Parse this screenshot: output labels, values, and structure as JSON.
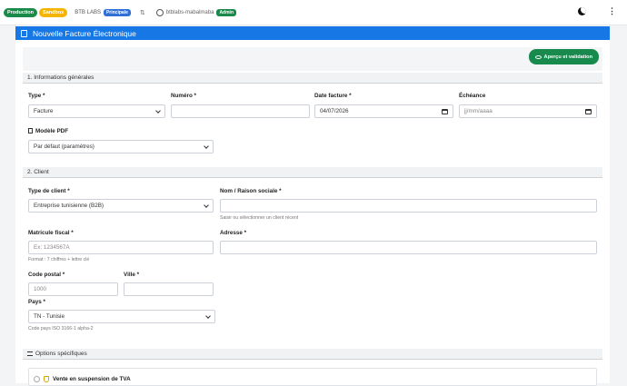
{
  "topbar": {
    "env_production": "Production",
    "env_sandbox": "Sandbox",
    "org_name": "BTB LABS",
    "org_badge": "Principale",
    "swap_icon": "swap-icon",
    "user_email": "btblabs-mabalmaba",
    "user_badge": "Admin"
  },
  "page": {
    "title": "Nouvelle Facture Électronique"
  },
  "toolbar": {
    "preview_button": "Aperçu et validation"
  },
  "section1": {
    "title": "1. Informations générales",
    "type_label": "Type *",
    "type_value": "Facture",
    "numero_label": "Numéro *",
    "numero_value": "",
    "date_label": "Date facture *",
    "date_value": "04/07/2026",
    "echeance_label": "Échéance",
    "echeance_placeholder": "jj/mm/aaaa",
    "modele_label": "Modèle PDF",
    "modele_value": "Par défaut (paramètres)"
  },
  "section2": {
    "title": "2. Client",
    "type_client_label": "Type de client *",
    "type_client_value": "Entreprise tunisienne (B2B)",
    "nom_label": "Nom / Raison sociale *",
    "nom_value": "",
    "nom_help": "Saisir ou sélectionner un client récent",
    "matricule_label": "Matricule fiscal *",
    "matricule_placeholder": "Ex: 1234567A",
    "matricule_help": "Format : 7 chiffres + lettre clé",
    "adresse_label": "Adresse *",
    "adresse_value": "",
    "cp_label": "Code postal *",
    "cp_placeholder": "1000",
    "ville_label": "Ville *",
    "ville_value": "",
    "pays_label": "Pays *",
    "pays_value": "TN - Tunisie",
    "pays_help": "Code pays ISO 3166-1 alpha-2"
  },
  "section3": {
    "title": "Options spécifiques",
    "tva_label": "Vente en suspension de TVA"
  }
}
